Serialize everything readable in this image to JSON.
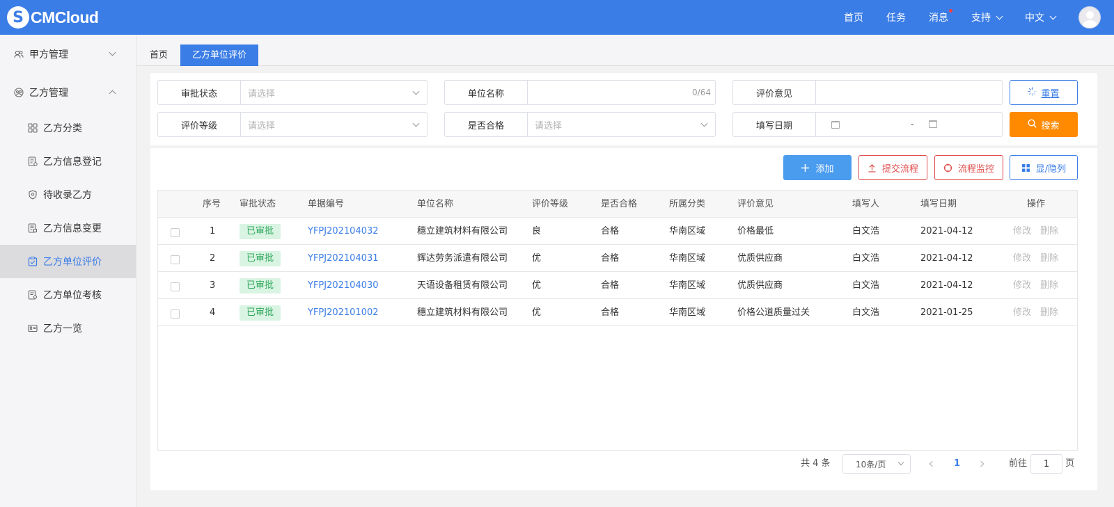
{
  "header": {
    "logo_mark": "S",
    "logo_text": "CMCloud",
    "nav": [
      {
        "label": "首页"
      },
      {
        "label": "任务"
      },
      {
        "label": "消息"
      },
      {
        "label": "支持"
      },
      {
        "label": "中文"
      }
    ]
  },
  "sidebar": {
    "groups": [
      {
        "label": "甲方管理"
      },
      {
        "label": "乙方管理"
      }
    ],
    "items": [
      {
        "label": "乙方分类"
      },
      {
        "label": "乙方信息登记"
      },
      {
        "label": "待收录乙方"
      },
      {
        "label": "乙方信息变更"
      },
      {
        "label": "乙方单位评价"
      },
      {
        "label": "乙方单位考核"
      },
      {
        "label": "乙方一览"
      }
    ]
  },
  "tabs": [
    {
      "label": "首页"
    },
    {
      "label": "乙方单位评价"
    }
  ],
  "filters": {
    "approval_status": {
      "label": "审批状态",
      "placeholder": "请选择"
    },
    "unit_name": {
      "label": "单位名称",
      "counter": "0/64"
    },
    "opinion": {
      "label": "评价意见"
    },
    "grade": {
      "label": "评价等级",
      "placeholder": "请选择"
    },
    "qualified": {
      "label": "是否合格",
      "placeholder": "请选择"
    },
    "fill_date": {
      "label": "填写日期",
      "separator": "-"
    },
    "reset_label": "重置",
    "search_label": "搜索"
  },
  "toolbar": {
    "add_label": "添加",
    "submit_label": "提交流程",
    "monitor_label": "流程监控",
    "toggle_label": "显/隐列"
  },
  "table": {
    "columns": [
      "序号",
      "审批状态",
      "单据编号",
      "单位名称",
      "评价等级",
      "是否合格",
      "所属分类",
      "评价意见",
      "填写人",
      "填写日期",
      "操作"
    ],
    "rows": [
      {
        "no": "1",
        "status": "已审批",
        "code": "YFPJ202104032",
        "unit": "穗立建筑材料有限公司",
        "grade": "良",
        "qualified": "合格",
        "category": "华南区域",
        "opinion": "价格最低",
        "filler": "白文浩",
        "date": "2021-04-12",
        "edit": "修改",
        "delete": "删除"
      },
      {
        "no": "2",
        "status": "已审批",
        "code": "YFPJ202104031",
        "unit": "辉达劳务派遣有限公司",
        "grade": "优",
        "qualified": "合格",
        "category": "华南区域",
        "opinion": "优质供应商",
        "filler": "白文浩",
        "date": "2021-04-12",
        "edit": "修改",
        "delete": "删除"
      },
      {
        "no": "3",
        "status": "已审批",
        "code": "YFPJ202104030",
        "unit": "天语设备租赁有限公司",
        "grade": "优",
        "qualified": "合格",
        "category": "华南区域",
        "opinion": "优质供应商",
        "filler": "白文浩",
        "date": "2021-04-12",
        "edit": "修改",
        "delete": "删除"
      },
      {
        "no": "4",
        "status": "已审批",
        "code": "YFPJ202101002",
        "unit": "穗立建筑材料有限公司",
        "grade": "优",
        "qualified": "合格",
        "category": "华南区域",
        "opinion": "价格公道质量过关",
        "filler": "白文浩",
        "date": "2021-01-25",
        "edit": "修改",
        "delete": "删除"
      }
    ]
  },
  "pagination": {
    "total": "共 4 条",
    "page_size": "10条/页",
    "current_page": "1",
    "goto_label": "前往",
    "goto_value": "1",
    "page_suffix": "页"
  },
  "colors": {
    "primary": "#3b7de6",
    "search": "#ff8a00",
    "danger": "#e04b4b",
    "approved_bg": "#d9f4e2",
    "approved_text": "#2da55a"
  }
}
